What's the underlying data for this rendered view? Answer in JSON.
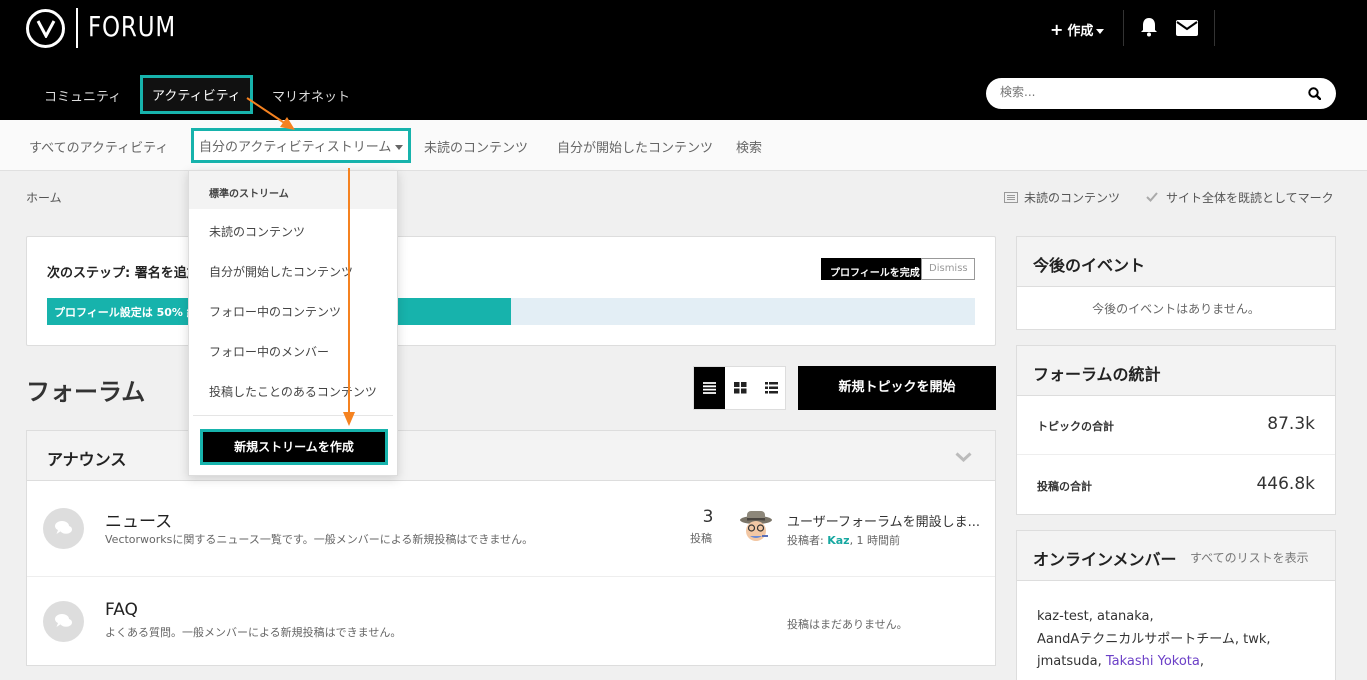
{
  "header": {
    "logo_text": "FORUM",
    "create_label": "作成",
    "nav": {
      "community": "コミュニティ",
      "activity": "アクティビティ",
      "marionette": "マリオネット"
    },
    "search_placeholder": "検索..."
  },
  "subnav": {
    "all_activity": "すべてのアクティビティ",
    "my_stream": "自分のアクティビティストリーム",
    "unread": "未読のコンテンツ",
    "started": "自分が開始したコンテンツ",
    "search": "検索"
  },
  "breadcrumb": {
    "home": "ホーム",
    "unread_link": "未読のコンテンツ",
    "mark_read": "サイト全体を既読としてマーク"
  },
  "profile": {
    "next_step": "次のステップ: 署名を追加",
    "complete_button": "プロフィールを完成",
    "dismiss_button": "Dismiss",
    "progress_label": "プロフィール設定は 50% 終了",
    "progress_fraction": 0.5
  },
  "dropdown": {
    "header": "標準のストリーム",
    "items": [
      "未読のコンテンツ",
      "自分が開始したコンテンツ",
      "フォロー中のコンテンツ",
      "フォロー中のメンバー",
      "投稿したことのあるコンテンツ"
    ],
    "create_button": "新規ストリームを作成"
  },
  "forums": {
    "heading": "フォーラム",
    "new_topic": "新規トピックを開始",
    "category": "アナウンス",
    "rows": [
      {
        "title": "ニュース",
        "desc": "Vectorworksに関するニュース一覧です。一般メンバーによる新規投稿はできません。",
        "count": "3",
        "count_label": "投稿",
        "last_title": "ユーザーフォーラムを開設しま...",
        "last_by_prefix": "投稿者: ",
        "last_user": "Kaz",
        "last_time": ", 1 時間前"
      },
      {
        "title": "FAQ",
        "desc": "よくある質問。一般メンバーによる新規投稿はできません。",
        "no_posts": "投稿はまだありません。"
      }
    ]
  },
  "sidebar": {
    "events_title": "今後のイベント",
    "events_empty": "今後のイベントはありません。",
    "stats_title": "フォーラムの統計",
    "stats": [
      {
        "label": "トピックの合計",
        "value": "87.3k"
      },
      {
        "label": "投稿の合計",
        "value": "446.8k"
      }
    ],
    "online_title": "オンラインメンバー",
    "online_link": "すべてのリストを表示",
    "online_plain_1": "kaz-test, atanaka,",
    "online_plain_2": "AandAテクニカルサポートチーム, twk,",
    "online_plain_3": "jmatsuda, ",
    "online_purple_1": "Takashi Yokota",
    "online_plain_4": ","
  },
  "colors": {
    "accent": "#17b3ac",
    "header_bg": "#000000",
    "arrow": "#f58220",
    "member_highlight": "#6b3fc7"
  }
}
